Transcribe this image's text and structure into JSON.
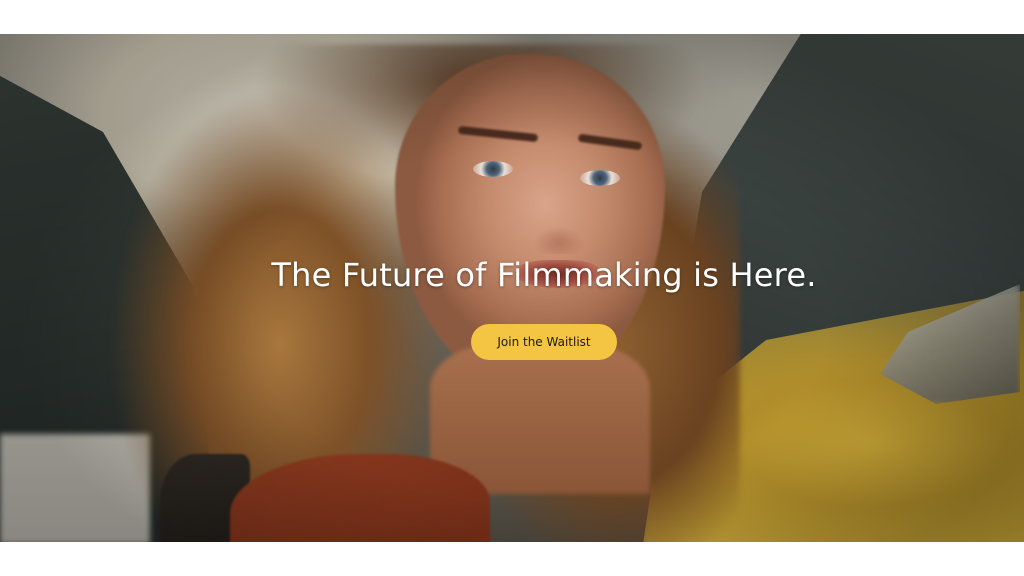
{
  "hero": {
    "headline": "The Future of Filmmaking is Here.",
    "cta_label": "Join the Waitlist",
    "image_description": ""
  },
  "colors": {
    "cta_background": "#f4c542",
    "headline_text": "#ffffff",
    "page_background": "#ffffff"
  }
}
